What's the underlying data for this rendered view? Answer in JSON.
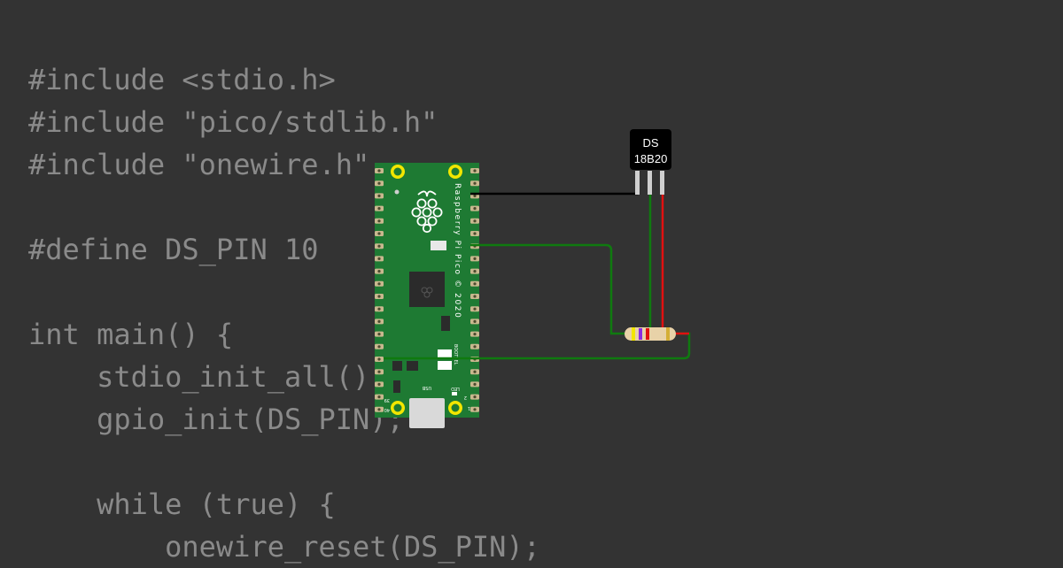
{
  "code_lines": [
    "#include <stdio.h>",
    "#include \"pico/stdlib.h\"",
    "#include \"onewire.h\"",
    "",
    "#define DS_PIN 10",
    "",
    "int main() {",
    "    stdio_init_all();",
    "    gpio_init(DS_PIN);",
    "",
    "    while (true) {",
    "        onewire_reset(DS_PIN);"
  ],
  "pico": {
    "silkscreen": "Raspberry Pi Pico © 2020",
    "bootsel_label": "BOOTSEL",
    "usb_label": "USB",
    "led_label": "LED",
    "pin1_label": "1",
    "pin2_label": "2",
    "pin39_label": "39",
    "pin40_label": "40"
  },
  "sensor": {
    "label_line1": "DS",
    "label_line2": "18B20"
  },
  "colors": {
    "background": "#333333",
    "code_text": "#8a8a8a",
    "board": "#1e7a33",
    "wire_green": "#0f7a0f",
    "wire_black": "#000000",
    "wire_red": "#e01010",
    "mount_hole": "#f2e600"
  }
}
